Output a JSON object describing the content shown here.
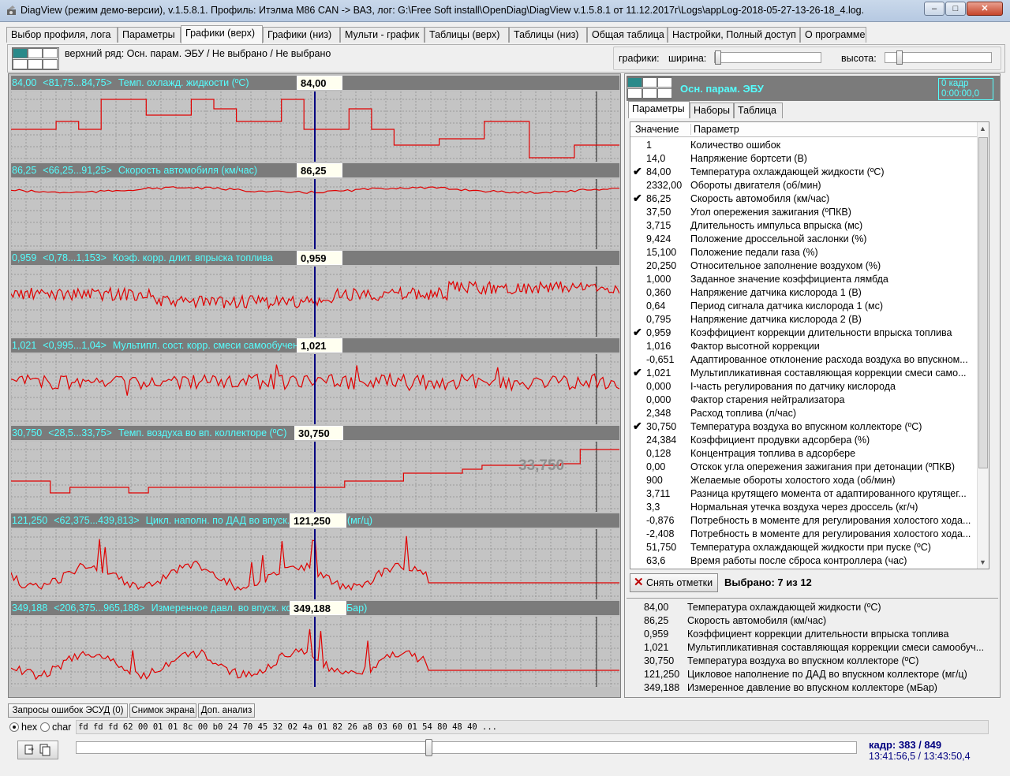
{
  "window": {
    "title": "DiagView (режим демо-версии), v.1.5.8.1. Профиль: Итэлма М86 CAN -> ВАЗ,    лог: G:\\Free Soft install\\OpenDiag\\DiagView v.1.5.8.1 от 11.12.2017г\\Logs\\appLog-2018-05-27-13-26-18_4.log.",
    "min": "‒",
    "max": "□",
    "close": "✕"
  },
  "tabs": [
    "Выбор профиля, лога",
    "Параметры",
    "Графики (верх)",
    "Графики (низ)",
    "Мульти - график",
    "Таблицы (верх)",
    "Таблицы (низ)",
    "Общая таблица",
    "Настройки, Полный доступ",
    "О программе"
  ],
  "active_tab": 2,
  "toppanel": {
    "row_text": "верхний ряд: Осн. парам. ЭБУ / Не выбрано / Не выбрано",
    "graphs_label": "графики:",
    "width_label": "ширина:",
    "height_label": "высота:"
  },
  "graphs": [
    {
      "value": "84,00",
      "range": "<81,75...84,75>",
      "name": "Темп. охлажд. жидкости (ºC)",
      "cursor": "84,00"
    },
    {
      "value": "86,25",
      "range": "<66,25...91,25>",
      "name": "Скорость автомобиля (км/час)",
      "cursor": "86,25"
    },
    {
      "value": "0,959",
      "range": "<0,78...1,153>",
      "name": "Коэф. корр. длит. впрыска топлива",
      "cursor": "0,959"
    },
    {
      "value": "1,021",
      "range": "<0,995...1,04>",
      "name": "Мультипл. сост. корр. смеси самообучения",
      "cursor": "1,021"
    },
    {
      "value": "30,750",
      "range": "<28,5...33,75>",
      "name": "Темп. воздуха во вп. коллекторе (ºC)",
      "cursor": "30,750",
      "ghost": "33,750"
    },
    {
      "value": "121,250",
      "range": "<62,375...439,813>",
      "name": "Цикл. наполн. по ДАД во впуск. коллекторе (мг/ц)",
      "cursor": "121,250"
    },
    {
      "value": "349,188",
      "range": "<206,375...965,188>",
      "name": "Измеренное давл. во впуск. коллекторе (мБар)",
      "cursor": "349,188"
    }
  ],
  "right": {
    "header_name": "Осн. парам. ЭБУ",
    "frame_line1": "0 кадр",
    "frame_line2": "0:00:00,0",
    "subtabs": [
      "Параметры",
      "Наборы",
      "Таблица"
    ],
    "col_value": "Значение",
    "col_param": "Параметр",
    "params": [
      {
        "v": "1",
        "p": "Количество ошибок",
        "c": false
      },
      {
        "v": "14,0",
        "p": "Напряжение бортсети (В)",
        "c": false
      },
      {
        "v": "84,00",
        "p": "Температура охлаждающей жидкости (ºC)",
        "c": true
      },
      {
        "v": "2332,00",
        "p": "Обороты двигателя (об/мин)",
        "c": false
      },
      {
        "v": "86,25",
        "p": "Скорость автомобиля (км/час)",
        "c": true
      },
      {
        "v": "37,50",
        "p": "Угол опережения зажигания (ºПКВ)",
        "c": false
      },
      {
        "v": "3,715",
        "p": "Длительность импульса впрыска (мс)",
        "c": false
      },
      {
        "v": "9,424",
        "p": "Положение дроссельной заслонки (%)",
        "c": false
      },
      {
        "v": "15,100",
        "p": "Положение педали газа (%)",
        "c": false
      },
      {
        "v": "20,250",
        "p": "Относительное заполнение воздухом (%)",
        "c": false
      },
      {
        "v": "1,000",
        "p": "Заданное значение коэффициента лямбда",
        "c": false
      },
      {
        "v": "0,360",
        "p": "Напряжение датчика кислорода 1 (В)",
        "c": false
      },
      {
        "v": "0,64",
        "p": "Период сигнала датчика кислорода 1 (мс)",
        "c": false
      },
      {
        "v": "0,795",
        "p": "Напряжение датчика кислорода 2 (В)",
        "c": false
      },
      {
        "v": "0,959",
        "p": "Коэффициент коррекции длительности впрыска топлива",
        "c": true
      },
      {
        "v": "1,016",
        "p": "Фактор высотной коррекции",
        "c": false
      },
      {
        "v": "-0,651",
        "p": "Адаптированное отклонение расхода воздуха во впускном...",
        "c": false
      },
      {
        "v": "1,021",
        "p": "Мультипликативная составляющая коррекции смеси само...",
        "c": true
      },
      {
        "v": "0,000",
        "p": "I-часть регулирования по датчику кислорода",
        "c": false
      },
      {
        "v": "0,000",
        "p": "Фактор старения нейтрализатора",
        "c": false
      },
      {
        "v": "2,348",
        "p": "Расход топлива (л/час)",
        "c": false
      },
      {
        "v": "30,750",
        "p": "Температура воздуха во впускном коллекторе (ºC)",
        "c": true
      },
      {
        "v": "24,384",
        "p": "Коэффициент продувки адсорбера (%)",
        "c": false
      },
      {
        "v": "0,128",
        "p": "Концентрация топлива в адсорбере",
        "c": false
      },
      {
        "v": "0,00",
        "p": "Отскок угла опережения зажигания при детонации (ºПКВ)",
        "c": false
      },
      {
        "v": "900",
        "p": "Желаемые обороты холостого хода (об/мин)",
        "c": false
      },
      {
        "v": "3,711",
        "p": "Разница крутящего момента от адаптированного крутящег...",
        "c": false
      },
      {
        "v": "3,3",
        "p": "Нормальная утечка воздуха через дроссель (кг/ч)",
        "c": false
      },
      {
        "v": "-0,876",
        "p": "Потребность в моменте для регулирования холостого хода...",
        "c": false
      },
      {
        "v": "-2,408",
        "p": "Потребность в моменте для регулирования холостого хода...",
        "c": false
      },
      {
        "v": "51,750",
        "p": "Температура охлаждающей жидкости при пуске (ºC)",
        "c": false
      },
      {
        "v": "63,6",
        "p": "Время работы после сброса контроллера (час)",
        "c": false
      }
    ],
    "check_mark": "✔",
    "unmark_label": "Снять отметки",
    "unmark_icon": "✕",
    "selected_text": "Выбрано: 7 из 12",
    "selected": [
      {
        "v": "84,00",
        "p": "Температура охлаждающей жидкости (ºC)"
      },
      {
        "v": "86,25",
        "p": "Скорость автомобиля (км/час)"
      },
      {
        "v": "0,959",
        "p": "Коэффициент коррекции длительности впрыска топлива"
      },
      {
        "v": "1,021",
        "p": "Мультипликативная составляющая коррекции смеси самообуч..."
      },
      {
        "v": "30,750",
        "p": "Температура воздуха во впускном коллекторе (ºC)"
      },
      {
        "v": "121,250",
        "p": "Цикловое наполнение по ДАД во впускном коллекторе (мг/ц)"
      },
      {
        "v": "349,188",
        "p": "Измеренное давление во впускном коллекторе (мБар)"
      }
    ]
  },
  "bottom": {
    "buttons": [
      "Запросы ошибок ЭСУД (0)",
      "Снимок экрана",
      "Доп. анализ"
    ],
    "hex_label": "hex",
    "char_label": "char",
    "hex_data": "fd fd fd 62 00 01 01 8c 00 b0 24 70 45 32 02 4a 01 82 26 a8 03 60 01 54 80 48 40 ...",
    "frame": "кадр: 383 / 849",
    "time": "13:41:56,5 / 13:43:50,4",
    "position_fraction": 0.451
  },
  "colors": {
    "trace": "#e00000",
    "cursor": "#000080",
    "bar_text": "#55ffff",
    "accent": "#2a8a8a"
  }
}
